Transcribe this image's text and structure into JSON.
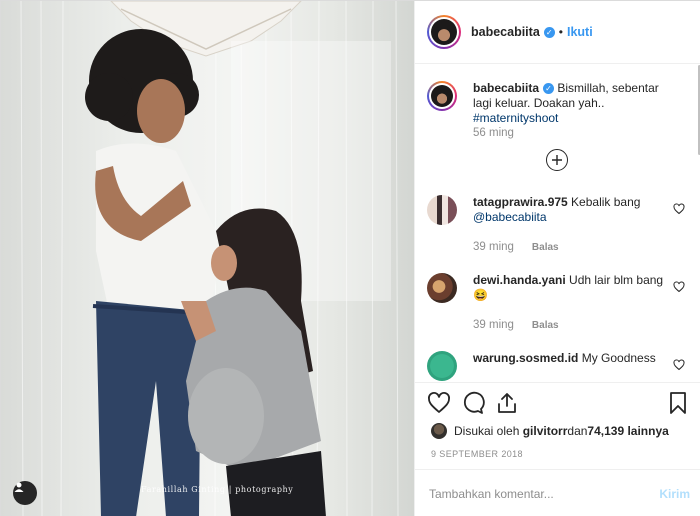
{
  "post": {
    "photo_credit": "Farahillah Ginting | photography",
    "username": "babecabiita",
    "verified_mark": "✓",
    "follow_label": "Ikuti",
    "separator": "•"
  },
  "caption": {
    "username": "babecabiita",
    "text": " Bismillah, sebentar lagi keluar. Doakan yah.. ",
    "hashtag": "#maternityshoot",
    "time": "56 ming"
  },
  "comments": [
    {
      "username": "tatagprawira.975",
      "text": " Kebalik bang ",
      "mention": "@babecabiita",
      "time": "39 ming",
      "reply_label": "Balas"
    },
    {
      "username": "dewi.handa.yani",
      "text": " Udh lair blm bang",
      "emoji": "😆",
      "time": "39 ming",
      "reply_label": "Balas"
    },
    {
      "username": "warung.sosmed.id",
      "text": " My Goodness"
    }
  ],
  "engagement": {
    "liked_prefix": "Disukai oleh ",
    "liked_user": "gilvitorr",
    "liked_mid": " dan ",
    "liked_count": "74,139 lainnya",
    "date": "9 SEPTEMBER 2018"
  },
  "composer": {
    "placeholder": "Tambahkan komentar...",
    "post_label": "Kirim"
  },
  "colors": {
    "accent": "#3897f0",
    "post_disabled": "#b2dffc",
    "muted": "#8e8e8e"
  },
  "icons": [
    "heart-icon",
    "comment-icon",
    "share-icon",
    "bookmark-icon",
    "add-comments-icon",
    "user-tag-icon"
  ]
}
